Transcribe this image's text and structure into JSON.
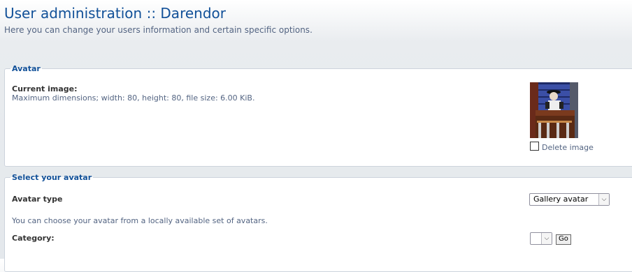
{
  "header": {
    "title": "User administration :: Darendor",
    "description": "Here you can change your users information and certain specific options."
  },
  "avatar_panel": {
    "legend": "Avatar",
    "current_image_label": "Current image:",
    "current_image_explain": "Maximum dimensions; width: 80, height: 80, file size: 6.00 KiB.",
    "delete_label": "Delete image",
    "delete_checked": false
  },
  "select_panel": {
    "legend": "Select your avatar",
    "avatar_type_label": "Avatar type",
    "avatar_type_value": "Gallery avatar",
    "gallery_explain": "You can choose your avatar from a locally available set of avatars.",
    "category_label": "Category:",
    "category_value": "",
    "go_label": "Go"
  },
  "colors": {
    "title": "#115098",
    "text": "#536482",
    "legend": "#115098"
  }
}
